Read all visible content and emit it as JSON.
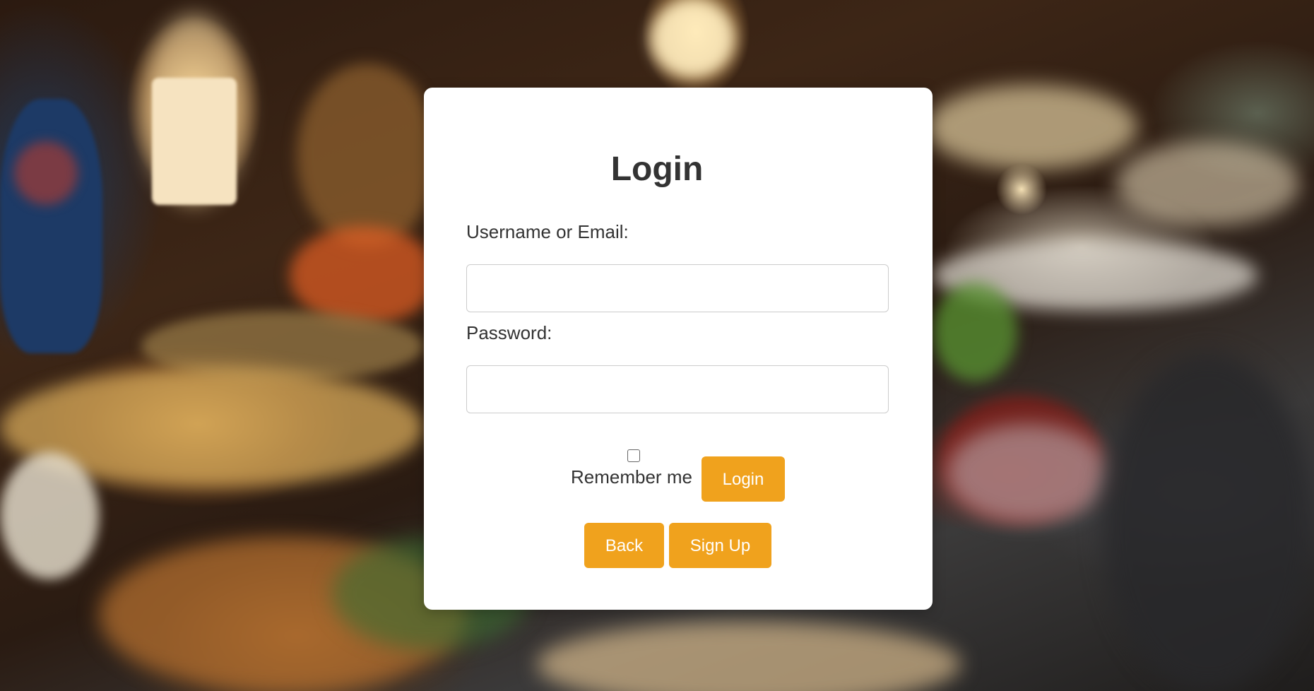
{
  "login_form": {
    "title": "Login",
    "username_label": "Username or Email:",
    "username_value": "",
    "password_label": "Password:",
    "password_value": "",
    "remember_label": "Remember me",
    "remember_checked": false,
    "login_button": "Login",
    "back_button": "Back",
    "signup_button": "Sign Up"
  },
  "colors": {
    "accent": "#f0a21d",
    "card_background": "#ffffff",
    "text": "#333333"
  }
}
